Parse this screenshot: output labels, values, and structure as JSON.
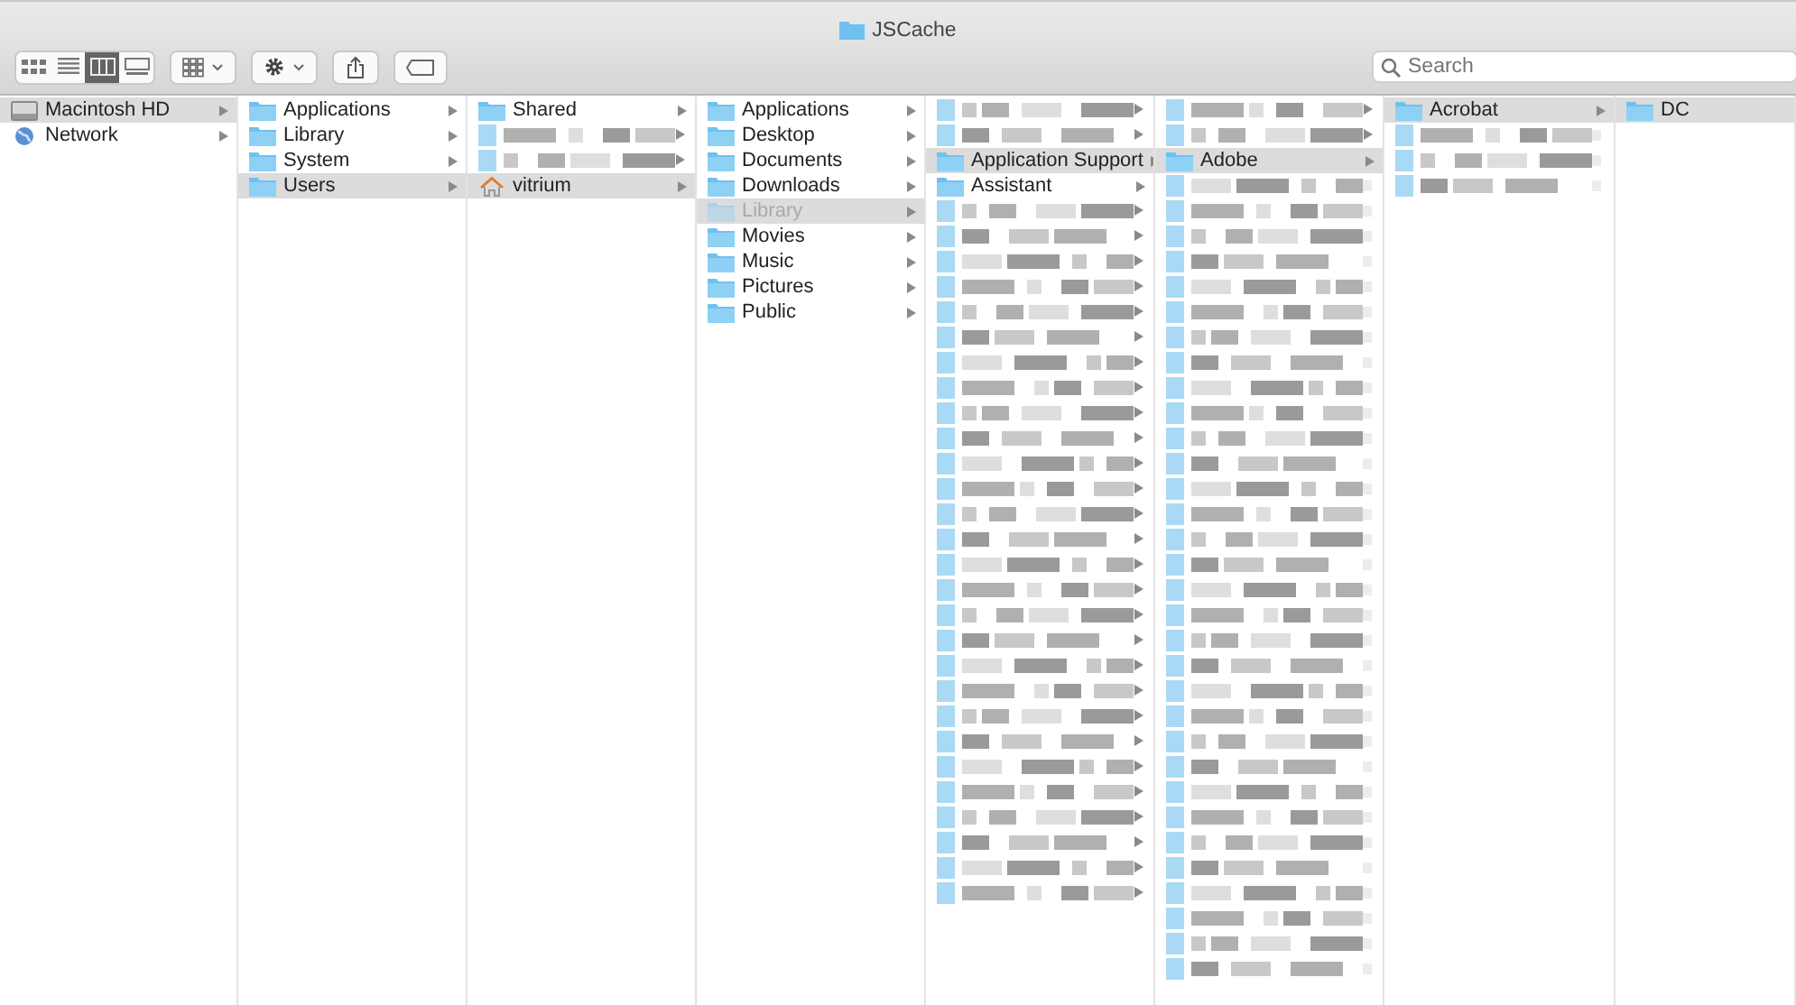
{
  "window": {
    "title": "JSCache"
  },
  "toolbar": {
    "view_modes": [
      {
        "kind": "icons",
        "selected": false
      },
      {
        "kind": "list",
        "selected": false
      },
      {
        "kind": "columns",
        "selected": true
      },
      {
        "kind": "gallery",
        "selected": false
      }
    ],
    "buttons": [
      {
        "kind": "group",
        "dropdown": true
      },
      {
        "kind": "action",
        "dropdown": true
      },
      {
        "kind": "share",
        "dropdown": false
      },
      {
        "kind": "tag",
        "dropdown": false
      }
    ]
  },
  "search": {
    "placeholder": "Search"
  },
  "columns": [
    {
      "items": [
        {
          "kind": "drive",
          "label": "Macintosh HD",
          "selected": true,
          "has_children": true
        },
        {
          "kind": "network",
          "label": "Network",
          "selected": false,
          "has_children": true
        }
      ]
    },
    {
      "items": [
        {
          "kind": "folder",
          "label": "Applications",
          "selected": false,
          "has_children": true
        },
        {
          "kind": "folder",
          "label": "Library",
          "selected": false,
          "has_children": true
        },
        {
          "kind": "folder",
          "label": "System",
          "selected": false,
          "has_children": true
        },
        {
          "kind": "folder",
          "label": "Users",
          "selected": true,
          "has_children": true
        }
      ]
    },
    {
      "items": [
        {
          "kind": "folder",
          "label": "Shared",
          "selected": false,
          "has_children": true
        },
        {
          "kind": "blurred",
          "has_children": true
        },
        {
          "kind": "blurred",
          "has_children": true
        },
        {
          "kind": "home",
          "label": "vitrium",
          "selected": true,
          "has_children": true
        }
      ]
    },
    {
      "items": [
        {
          "kind": "folder",
          "label": "Applications",
          "selected": false,
          "has_children": true
        },
        {
          "kind": "folder",
          "label": "Desktop",
          "selected": false,
          "has_children": true
        },
        {
          "kind": "folder",
          "label": "Documents",
          "selected": false,
          "has_children": true
        },
        {
          "kind": "folder",
          "label": "Downloads",
          "selected": false,
          "has_children": true
        },
        {
          "kind": "folder",
          "label": "Library",
          "selected": true,
          "hidden": true,
          "has_children": true
        },
        {
          "kind": "folder",
          "label": "Movies",
          "selected": false,
          "has_children": true
        },
        {
          "kind": "folder",
          "label": "Music",
          "selected": false,
          "has_children": true
        },
        {
          "kind": "folder",
          "label": "Pictures",
          "selected": false,
          "has_children": true
        },
        {
          "kind": "folder",
          "label": "Public",
          "selected": false,
          "has_children": true
        }
      ]
    },
    {
      "items": [
        {
          "kind": "blurred",
          "has_children": true
        },
        {
          "kind": "blurred",
          "has_children": true
        },
        {
          "kind": "folder",
          "label": "Application Support",
          "selected": true,
          "has_children": true
        },
        {
          "kind": "folder",
          "label": "Assistant",
          "selected": false,
          "has_children": true
        },
        {
          "kind": "blurred",
          "has_children": true
        },
        {
          "kind": "blurred",
          "has_children": true
        },
        {
          "kind": "blurred",
          "has_children": true
        },
        {
          "kind": "blurred",
          "has_children": true
        },
        {
          "kind": "blurred",
          "has_children": true
        },
        {
          "kind": "blurred",
          "has_children": true
        },
        {
          "kind": "blurred",
          "has_children": true
        },
        {
          "kind": "blurred",
          "has_children": true
        },
        {
          "kind": "blurred",
          "has_children": true
        },
        {
          "kind": "blurred",
          "has_children": true
        },
        {
          "kind": "blurred",
          "has_children": true
        },
        {
          "kind": "blurred",
          "has_children": true
        },
        {
          "kind": "blurred",
          "has_children": true
        },
        {
          "kind": "blurred",
          "has_children": true
        },
        {
          "kind": "blurred",
          "has_children": true
        },
        {
          "kind": "blurred",
          "has_children": true
        },
        {
          "kind": "blurred",
          "has_children": true
        },
        {
          "kind": "blurred",
          "has_children": true
        },
        {
          "kind": "blurred",
          "has_children": true
        },
        {
          "kind": "blurred",
          "has_children": true
        },
        {
          "kind": "blurred",
          "has_children": true
        },
        {
          "kind": "blurred",
          "has_children": true
        },
        {
          "kind": "blurred",
          "has_children": true
        },
        {
          "kind": "blurred",
          "has_children": true
        },
        {
          "kind": "blurred",
          "has_children": true
        },
        {
          "kind": "blurred",
          "has_children": true
        },
        {
          "kind": "blurred",
          "has_children": true
        },
        {
          "kind": "blurred",
          "has_children": true
        }
      ]
    },
    {
      "items": [
        {
          "kind": "blurred",
          "has_children": true
        },
        {
          "kind": "blurred",
          "has_children": true
        },
        {
          "kind": "folder",
          "label": "Adobe",
          "selected": true,
          "has_children": true
        },
        {
          "kind": "blurred",
          "has_children": false
        },
        {
          "kind": "blurred",
          "has_children": false
        },
        {
          "kind": "blurred",
          "has_children": false
        },
        {
          "kind": "blurred",
          "has_children": false
        },
        {
          "kind": "blurred",
          "has_children": false
        },
        {
          "kind": "blurred",
          "has_children": false
        },
        {
          "kind": "blurred",
          "has_children": false
        },
        {
          "kind": "blurred",
          "has_children": false
        },
        {
          "kind": "blurred",
          "has_children": false
        },
        {
          "kind": "blurred",
          "has_children": false
        },
        {
          "kind": "blurred",
          "has_children": false
        },
        {
          "kind": "blurred",
          "has_children": false
        },
        {
          "kind": "blurred",
          "has_children": false
        },
        {
          "kind": "blurred",
          "has_children": false
        },
        {
          "kind": "blurred",
          "has_children": false
        },
        {
          "kind": "blurred",
          "has_children": false
        },
        {
          "kind": "blurred",
          "has_children": false
        },
        {
          "kind": "blurred",
          "has_children": false
        },
        {
          "kind": "blurred",
          "has_children": false
        },
        {
          "kind": "blurred",
          "has_children": false
        },
        {
          "kind": "blurred",
          "has_children": false
        },
        {
          "kind": "blurred",
          "has_children": false
        },
        {
          "kind": "blurred",
          "has_children": false
        },
        {
          "kind": "blurred",
          "has_children": false
        },
        {
          "kind": "blurred",
          "has_children": false
        },
        {
          "kind": "blurred",
          "has_children": false
        },
        {
          "kind": "blurred",
          "has_children": false
        },
        {
          "kind": "blurred",
          "has_children": false
        },
        {
          "kind": "blurred",
          "has_children": false
        },
        {
          "kind": "blurred",
          "has_children": false
        },
        {
          "kind": "blurred",
          "has_children": false
        },
        {
          "kind": "blurred",
          "has_children": false
        }
      ]
    },
    {
      "items": [
        {
          "kind": "folder",
          "label": "Acrobat",
          "selected": true,
          "has_children": true
        },
        {
          "kind": "blurred",
          "has_children": false
        },
        {
          "kind": "blurred",
          "has_children": false
        },
        {
          "kind": "blurred",
          "has_children": false
        }
      ]
    },
    {
      "items": [
        {
          "kind": "folder",
          "label": "DC",
          "selected": true,
          "has_children": false
        }
      ]
    }
  ]
}
